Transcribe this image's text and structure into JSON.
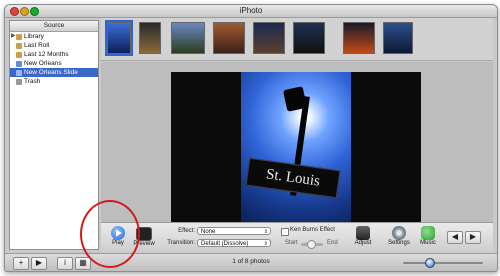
{
  "window": {
    "title": "iPhoto"
  },
  "sidebar": {
    "header": "Source",
    "items": [
      {
        "label": "Library",
        "icon": "library-icon",
        "color": "#c9a04a"
      },
      {
        "label": "Last Roll",
        "icon": "film-roll-icon",
        "color": "#c9a04a"
      },
      {
        "label": "Last 12 Months",
        "icon": "calendar-icon",
        "color": "#c9a04a"
      },
      {
        "label": "New Orleans",
        "icon": "album-icon",
        "color": "#5a8fd6"
      },
      {
        "label": "New Orleans Slide",
        "icon": "slideshow-icon",
        "color": "#9bb7e8"
      },
      {
        "label": "Trash",
        "icon": "trash-icon",
        "color": "#999999"
      }
    ]
  },
  "viewer": {
    "sign_text": "St. Louis"
  },
  "controls": {
    "play_label": "Play",
    "preview_label": "Preview",
    "effect_label": "Effect:",
    "effect_value": "None",
    "transition_label": "Transition:",
    "transition_value": "Default (Dissolve)",
    "ken_burns_label": "Ken Burns Effect",
    "start_label": "Start",
    "end_label": "End",
    "adjust_label": "Adjust",
    "settings_label": "Settings",
    "music_label": "Music",
    "prev_arrow": "◀",
    "next_arrow": "▶"
  },
  "bottombar": {
    "add": "+",
    "play": "▶",
    "info": "i",
    "photo_count": "1 of 8 photos"
  },
  "colors": {
    "accent": "#3a67c9",
    "annotation": "#d31b1b"
  }
}
